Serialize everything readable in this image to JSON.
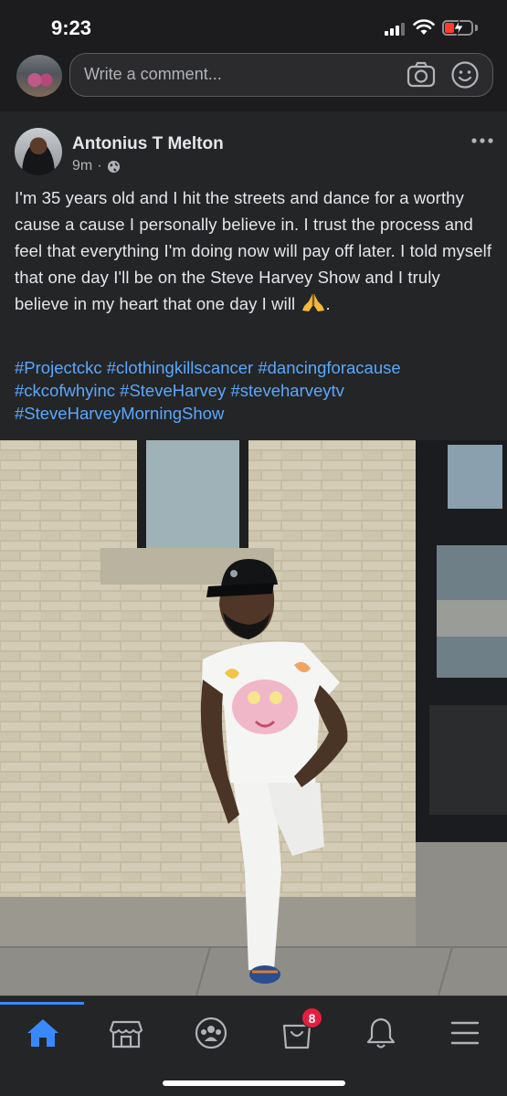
{
  "status_bar": {
    "time": "9:23",
    "icons": [
      "signal-icon",
      "wifi-icon",
      "battery-charging-icon"
    ],
    "battery_color": "#ff3b30"
  },
  "comment_bar": {
    "placeholder": "Write a comment...",
    "icons": [
      "camera-icon",
      "emoji-icon"
    ]
  },
  "post": {
    "author": "Antonius T Melton",
    "time": "9m",
    "separator": "·",
    "privacy_icon": "globe-icon",
    "text": "I'm 35 years old and I hit the streets and dance for a worthy cause a cause I personally believe in. I trust the process and feel that everything I'm doing now will pay off later. I told myself that one day I'll be on the Steve Harvey Show and I truly believe in my heart that one day I will",
    "text_end_emoji": "folded-hands-emoji",
    "text_end": ".",
    "hashtags": [
      "#Projectckc",
      "#clothingkillscancer",
      "#dancingforacause",
      "#ckcofwhyinc",
      "#SteveHarvey",
      "#steveharveytv",
      "#SteveHarveyMorningShow"
    ],
    "hashtag_color": "#5aa7ff",
    "photo_icon": "photo-man-brick-wall"
  },
  "bottom_nav": {
    "items": [
      "home-icon",
      "marketplace-icon",
      "groups-icon",
      "shopping-bag-icon",
      "bell-icon",
      "menu-icon"
    ],
    "active": "home-icon",
    "badge": "8",
    "accent": "#3a88fe",
    "badge_color": "#e41e3f"
  }
}
